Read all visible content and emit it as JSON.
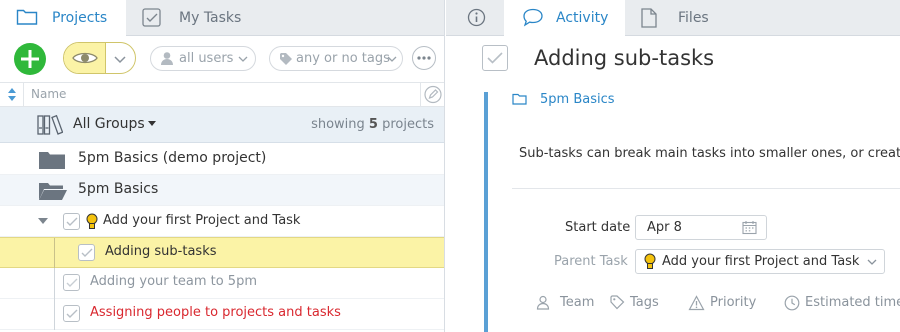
{
  "left_tabs": [
    {
      "label": "Projects",
      "icon": "folder-icon",
      "active": true
    },
    {
      "label": "My Tasks",
      "icon": "checkbox-icon",
      "active": false
    }
  ],
  "toolbar": {
    "add_icon": "plus-icon",
    "view_icon": "eye-icon",
    "users_filter": "all users",
    "tags_filter": "any or no tags",
    "more_icon": "ellipsis-icon"
  },
  "columns": {
    "name": "Name"
  },
  "groups_bar": {
    "title": "All Groups",
    "showing_prefix": "showing",
    "showing_count": "5",
    "showing_suffix": "projects"
  },
  "tree": [
    {
      "type": "project",
      "label": "5pm Basics (demo project)",
      "folder": "closed"
    },
    {
      "type": "project",
      "label": "5pm Basics",
      "folder": "open"
    },
    {
      "type": "task",
      "label": "Add your first Project and Task",
      "expanded": true,
      "bulb": true
    },
    {
      "type": "subtask",
      "label": "Adding sub-tasks",
      "selected": true
    },
    {
      "type": "task",
      "label": "Adding your team to 5pm",
      "muted": true
    },
    {
      "type": "task",
      "label": "Assigning people to projects and tasks",
      "overdue": true
    }
  ],
  "right_tabs": [
    {
      "label": "",
      "icon": "info-icon"
    },
    {
      "label": "Activity",
      "icon": "speech-bubble-icon",
      "active": true
    },
    {
      "label": "Files",
      "icon": "file-icon",
      "active": false
    }
  ],
  "detail": {
    "title": "Adding sub-tasks",
    "project": "5pm Basics",
    "description": "Sub-tasks can break main tasks into smaller ones, or create tas",
    "start_date_label": "Start date",
    "start_date": "Apr 8",
    "parent_task_label": "Parent Task",
    "parent_task": "Add your first Project and Task",
    "meta": [
      {
        "label": "Team",
        "icon": "team-icon"
      },
      {
        "label": "Tags",
        "icon": "tag-icon"
      },
      {
        "label": "Priority",
        "icon": "warning-icon"
      },
      {
        "label": "Estimated time",
        "icon": "clock-icon"
      }
    ]
  },
  "colors": {
    "accent": "#2a86c7",
    "green": "#2fb83a",
    "highlight": "#fbf3a6",
    "overdue": "#d9282f",
    "group_bar": "#e9f0f6"
  }
}
